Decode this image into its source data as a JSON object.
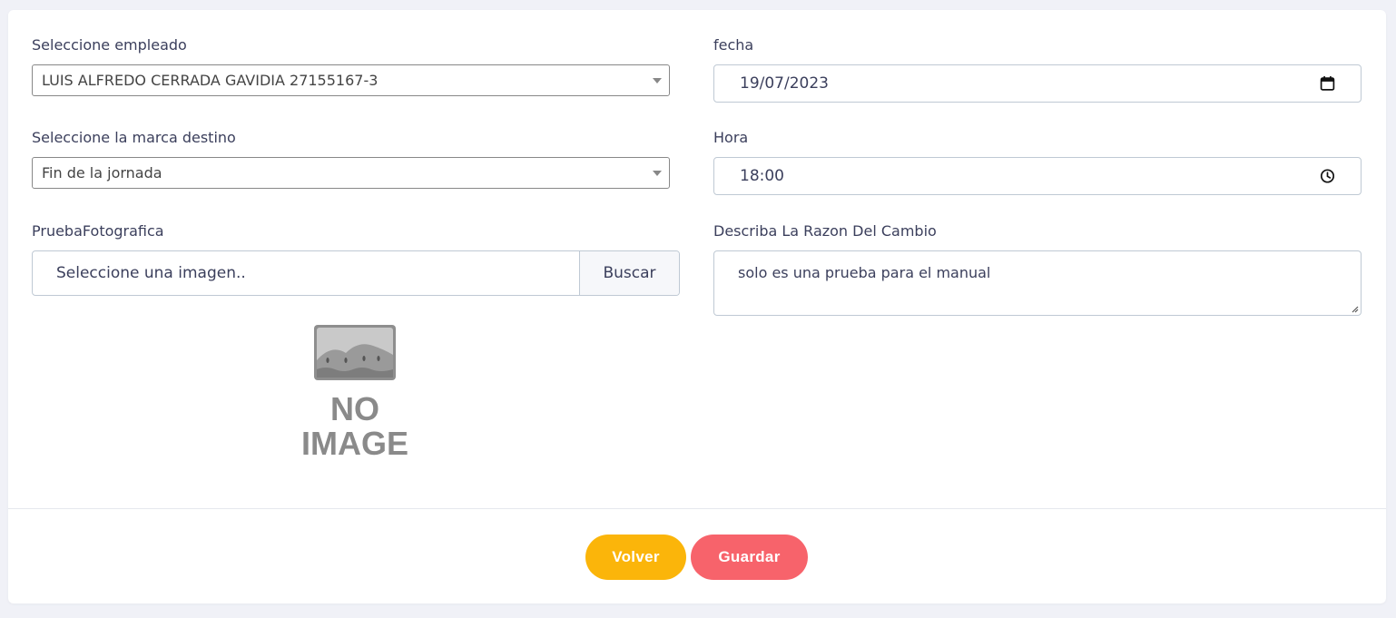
{
  "form": {
    "employee": {
      "label": "Seleccione empleado",
      "value": "LUIS ALFREDO CERRADA GAVIDIA 27155167-3"
    },
    "date": {
      "label": "fecha",
      "value": "19/07/2023"
    },
    "mark": {
      "label": "Seleccione la marca destino",
      "value": "Fin de la jornada"
    },
    "time": {
      "label": "Hora",
      "value": "18:00"
    },
    "photo": {
      "label": "PruebaFotografica",
      "placeholder": "Seleccione una imagen..",
      "button": "Buscar",
      "preview_text_1": "NO",
      "preview_text_2": "IMAGE"
    },
    "reason": {
      "label": "Describa La Razon Del Cambio",
      "value": "solo es una prueba para el manual"
    }
  },
  "actions": {
    "back_label": "Volver",
    "save_label": "Guardar"
  },
  "colors": {
    "back": "#fbb50a",
    "save": "#f7636b"
  },
  "icons": {
    "date": "calendar-icon",
    "time": "clock-icon",
    "select": "chevron-down-icon"
  }
}
